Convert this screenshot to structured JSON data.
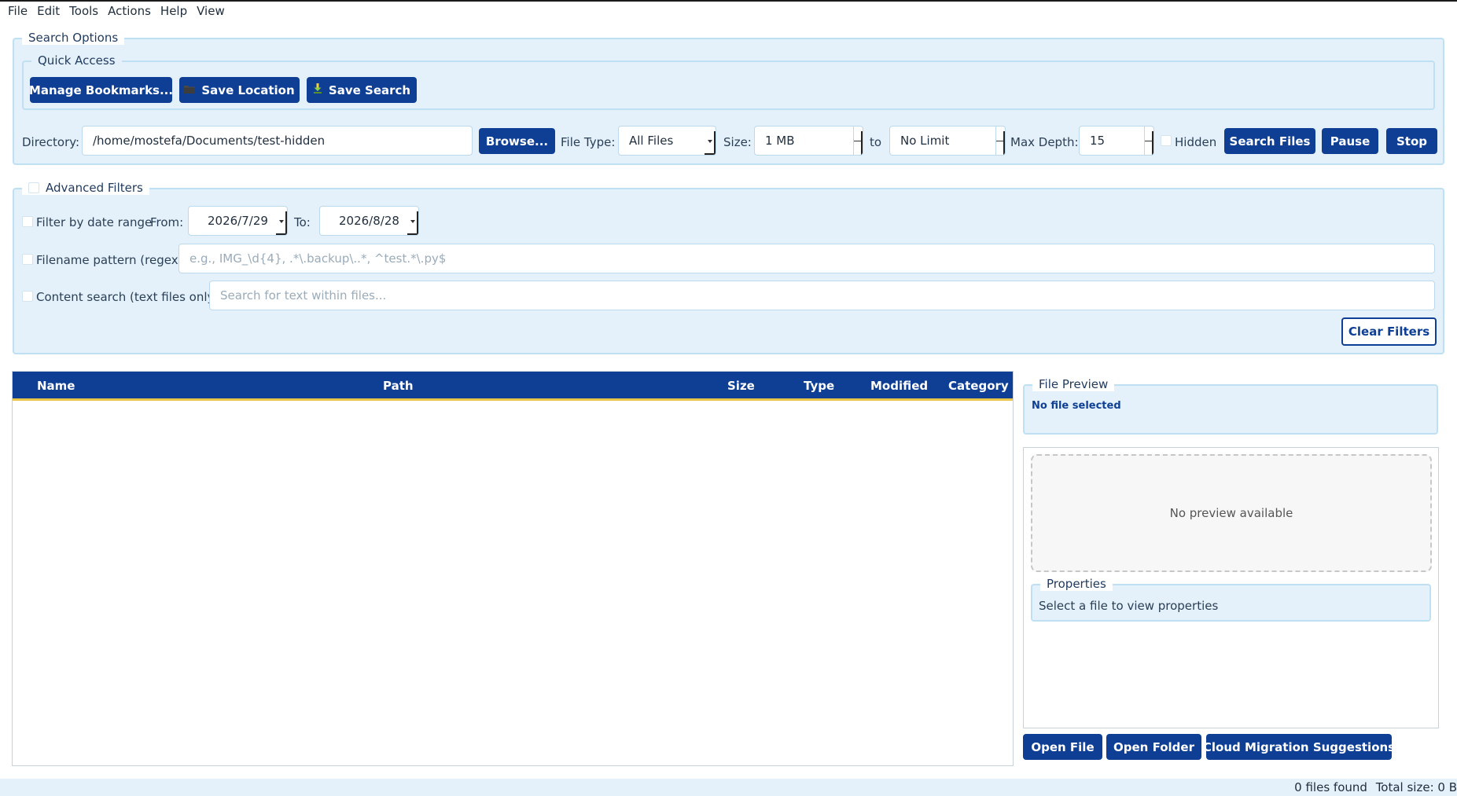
{
  "menu": [
    "File",
    "Edit",
    "Tools",
    "Actions",
    "Help",
    "View"
  ],
  "search_options": {
    "title": "Search Options",
    "quick_access": {
      "title": "Quick Access",
      "manage_bookmarks": "Manage Bookmarks...",
      "save_location": "Save Location",
      "save_location_icon": "folder-icon",
      "save_search": "Save Search",
      "save_search_icon": "download-icon"
    },
    "directory_label": "Directory:",
    "directory_value": "/home/mostefa/Documents/test-hidden",
    "browse": "Browse...",
    "file_type_label": "File Type:",
    "file_type_value": "All Files",
    "size_label": "Size:",
    "size_min": "1 MB",
    "size_to": "to",
    "size_max": "No Limit",
    "max_depth_label": "Max Depth:",
    "max_depth_value": "15",
    "hidden_label": "Hidden",
    "search_files": "Search Files",
    "pause": "Pause",
    "stop": "Stop"
  },
  "advanced_filters": {
    "title": "Advanced Filters",
    "date_range_label": "Filter by date range",
    "from_label": "From:",
    "from_value": "2026/7/29",
    "to_label": "To:",
    "to_value": "2026/8/28",
    "filename_pattern_label": "Filename pattern (regex)",
    "filename_pattern_placeholder": "e.g., IMG_\\d{4}, .*\\.backup\\..*, ^test.*\\.py$",
    "content_search_label": "Content search (text files only)",
    "content_search_placeholder": "Search for text within files...",
    "clear_filters": "Clear Filters"
  },
  "results_table": {
    "columns": [
      "Name",
      "Path",
      "Size",
      "Type",
      "Modified",
      "Category"
    ],
    "rows": []
  },
  "file_preview": {
    "title": "File Preview",
    "selection_text": "No file selected",
    "no_preview": "No preview available",
    "properties_title": "Properties",
    "properties_text": "Select a file to view properties"
  },
  "actions": {
    "open_file": "Open File",
    "open_folder": "Open Folder",
    "cloud_migration": "Cloud Migration Suggestions"
  },
  "status": {
    "files_found": "0 files found",
    "total_size": "Total size: 0 B"
  },
  "colors": {
    "primary": "#0e3f94",
    "panel_bg": "#e4f1fb",
    "panel_border": "#bfe0f3",
    "header_underline": "#e8c548"
  }
}
